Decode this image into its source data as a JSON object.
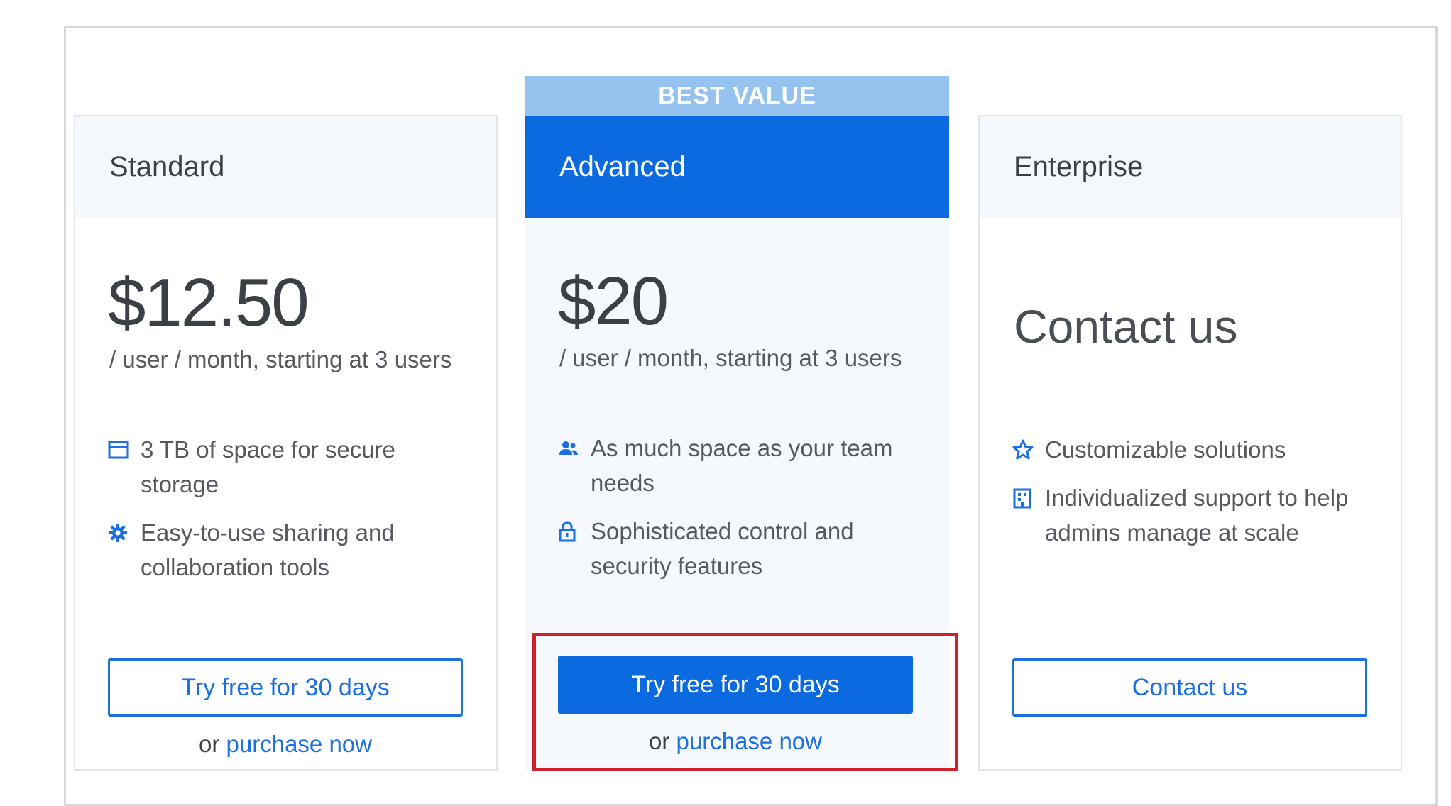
{
  "plans": [
    {
      "name": "Standard",
      "price": "$12.50",
      "price_sub": "/ user / month, starting at 3 users",
      "features": [
        {
          "icon": "calendar-storage-icon",
          "text": "3 TB of space for secure storage"
        },
        {
          "icon": "gear-icon",
          "text": "Easy-to-use sharing and collaboration tools"
        }
      ],
      "cta": "Try free for 30 days",
      "alt_prefix": "or",
      "alt_link": "purchase now"
    },
    {
      "badge": "BEST VALUE",
      "name": "Advanced",
      "price": "$20",
      "price_sub": "/ user / month, starting at 3 users",
      "features": [
        {
          "icon": "users-icon",
          "text": "As much space as your team needs"
        },
        {
          "icon": "lock-icon",
          "text": "Sophisticated control and security features"
        }
      ],
      "cta": "Try free for 30 days",
      "alt_prefix": "or",
      "alt_link": "purchase now"
    },
    {
      "name": "Enterprise",
      "price": "Contact us",
      "features": [
        {
          "icon": "star-icon",
          "text": "Customizable solutions"
        },
        {
          "icon": "building-icon",
          "text": "Individualized support to help admins manage at scale"
        }
      ],
      "cta": "Contact us"
    }
  ],
  "colors": {
    "brand_blue": "#0b6ae0",
    "badge_blue": "#95c2ef",
    "highlight_red": "#d0202a"
  }
}
